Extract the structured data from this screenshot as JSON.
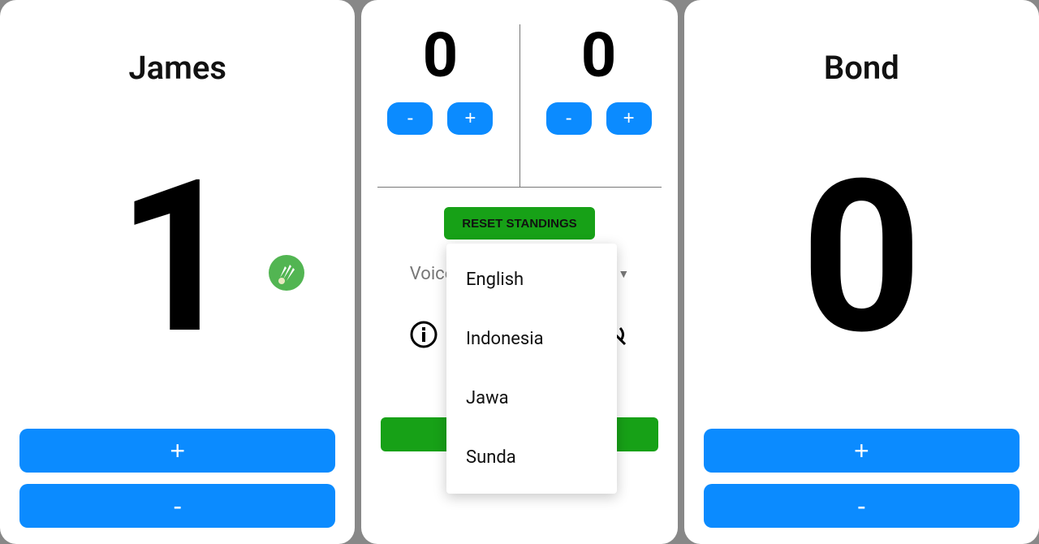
{
  "left": {
    "name": "James",
    "score": "1",
    "hasShuttle": true,
    "plus": "+",
    "minus": "-"
  },
  "right": {
    "name": "Bond",
    "score": "0",
    "plus": "+",
    "minus": "-"
  },
  "center": {
    "standings": {
      "left": "0",
      "right": "0",
      "plus": "+",
      "minus": "-"
    },
    "reset_label": "RESET STANDINGS",
    "voice_label": "Voice :",
    "selected_voice": "English",
    "bottom_left": "",
    "bottom_right": ""
  },
  "voice_options": [
    "English",
    "Indonesia",
    "Jawa",
    "Sunda"
  ]
}
